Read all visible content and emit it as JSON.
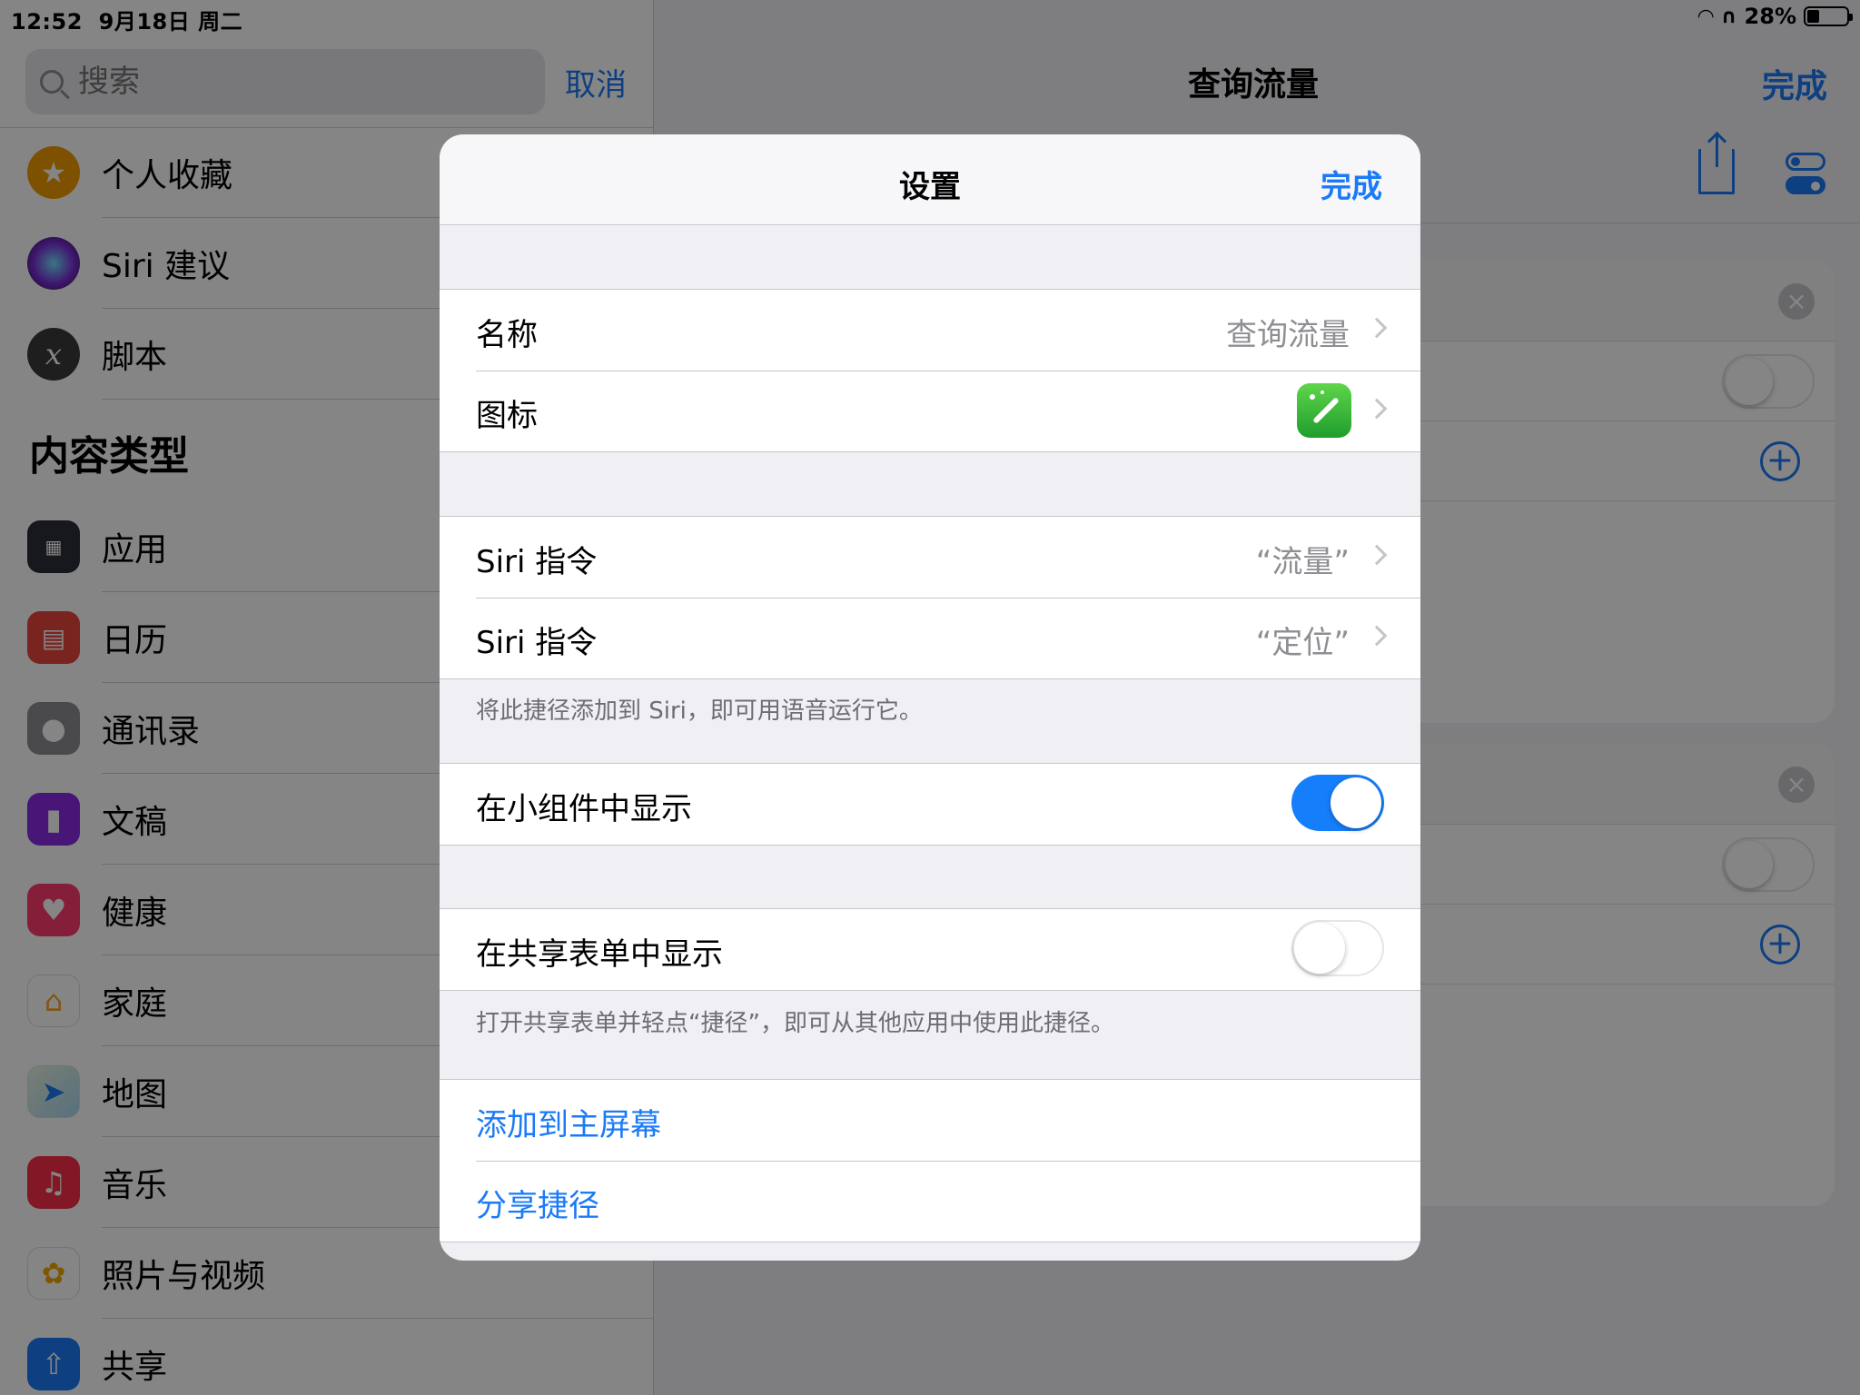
{
  "status": {
    "time": "12:52",
    "date": "9月18日 周二",
    "battery": "28%",
    "battery_level": 0.28
  },
  "search": {
    "placeholder": "搜索",
    "cancel": "取消"
  },
  "sidebar": {
    "top_items": [
      {
        "label": "个人收藏",
        "icon": "star-icon",
        "color": "#f29b00"
      },
      {
        "label": "Siri 建议",
        "icon": "siri-icon",
        "color": "#3a2b6b"
      },
      {
        "label": "脚本",
        "icon": "script-x-icon",
        "color": "#3a3a3c"
      }
    ],
    "section_title": "内容类型",
    "items": [
      {
        "label": "应用",
        "icon": "apps-grid-icon",
        "color": "#2c2c3a"
      },
      {
        "label": "日历",
        "icon": "calendar-icon",
        "color": "#e8453c"
      },
      {
        "label": "通讯录",
        "icon": "contacts-icon",
        "color": "#8e8e93"
      },
      {
        "label": "文稿",
        "icon": "document-icon",
        "color": "#8a2be2"
      },
      {
        "label": "健康",
        "icon": "heart-icon",
        "color": "#ff3b6b"
      },
      {
        "label": "家庭",
        "icon": "home-icon",
        "color": "#ffffff"
      },
      {
        "label": "地图",
        "icon": "map-icon",
        "color": "#e8f3e0"
      },
      {
        "label": "音乐",
        "icon": "music-icon",
        "color": "#fa2d48"
      },
      {
        "label": "照片与视频",
        "icon": "photos-icon",
        "color": "#ffffff"
      },
      {
        "label": "共享",
        "icon": "share-icon",
        "color": "#1a7af8"
      }
    ]
  },
  "main": {
    "title": "查询流量",
    "done": "完成"
  },
  "modal": {
    "title": "设置",
    "done": "完成",
    "name": {
      "label": "名称",
      "value": "查询流量"
    },
    "icon": {
      "label": "图标"
    },
    "siri": [
      {
        "label": "Siri 指令",
        "value": "“流量”"
      },
      {
        "label": "Siri 指令",
        "value": "“定位”"
      }
    ],
    "siri_footer": "将此捷径添加到 Siri，即可用语音运行它。",
    "widget": {
      "label": "在小组件中显示",
      "on": true
    },
    "share_sheet": {
      "label": "在共享表单中显示",
      "on": false
    },
    "share_footer": "打开共享表单并轻点“捷径”，即可从其他应用中使用此捷径。",
    "add_home": "添加到主屏幕",
    "share_shortcut": "分享捷径"
  },
  "colors": {
    "accent": "#1a7af8",
    "switch_on": "#157efb"
  }
}
